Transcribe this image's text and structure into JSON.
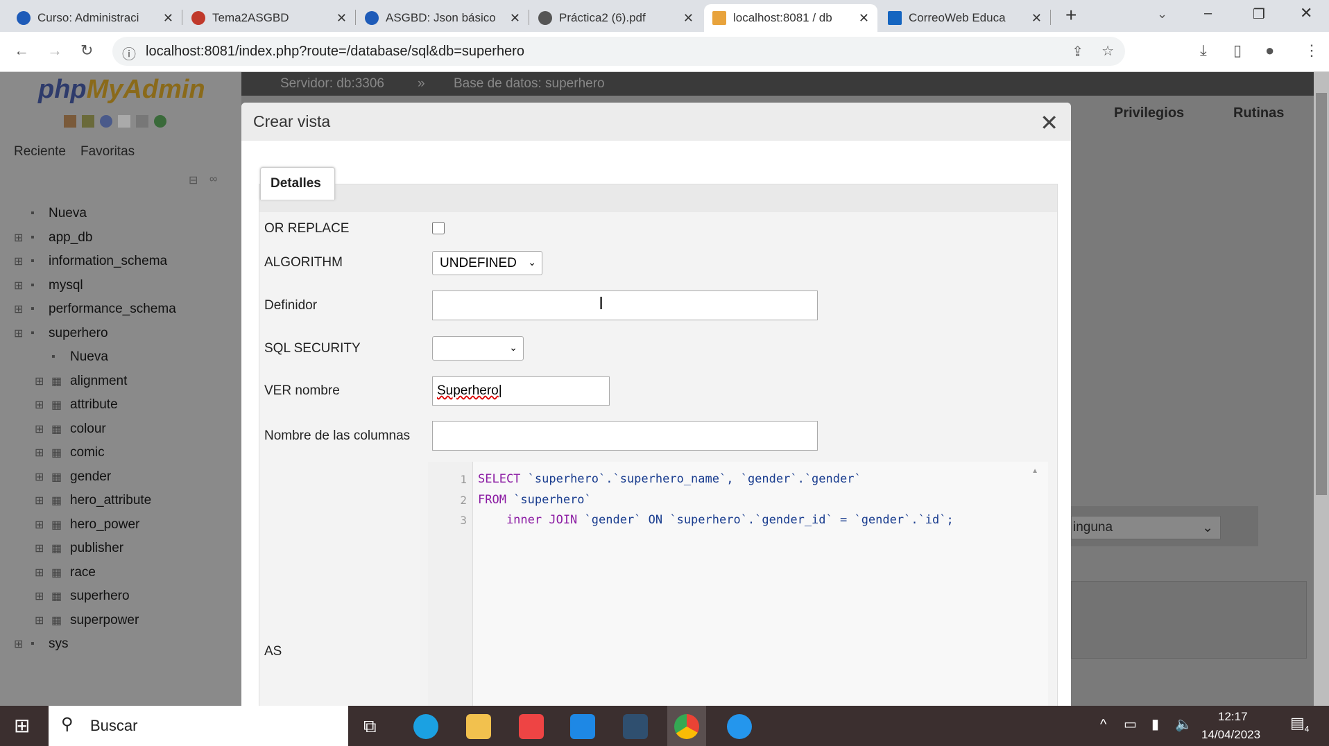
{
  "browser": {
    "tabs": [
      {
        "label": "Curso: Administraci",
        "color": "#1e5bb8"
      },
      {
        "label": "Tema2ASGBD",
        "color": "#c0392b"
      },
      {
        "label": "ASGBD: Json básico",
        "color": "#1e5bb8"
      },
      {
        "label": "Práctica2 (6).pdf",
        "color": "#555"
      },
      {
        "label": "localhost:8081 / db",
        "color": "#e8a33c"
      },
      {
        "label": "CorreoWeb Educa",
        "color": "#1565c0"
      }
    ],
    "url": "localhost:8081/index.php?route=/database/sql&db=superhero"
  },
  "pma": {
    "logo_php": "php",
    "logo_myadmin": "MyAdmin",
    "recent": "Reciente",
    "favorites": "Favoritas",
    "breadcrumb_server": "Servidor: db:3306",
    "breadcrumb_sep": "»",
    "breadcrumb_db": "Base de datos: superhero",
    "tab_privileges": "Privilegios",
    "tab_routines": "Rutinas",
    "behind_select": "inguna"
  },
  "tree": [
    {
      "label": "Nueva",
      "level": 0
    },
    {
      "label": "app_db",
      "level": 0
    },
    {
      "label": "information_schema",
      "level": 0
    },
    {
      "label": "mysql",
      "level": 0
    },
    {
      "label": "performance_schema",
      "level": 0
    },
    {
      "label": "superhero",
      "level": 0
    },
    {
      "label": "Nueva",
      "level": 1
    },
    {
      "label": "alignment",
      "level": 1
    },
    {
      "label": "attribute",
      "level": 1
    },
    {
      "label": "colour",
      "level": 1
    },
    {
      "label": "comic",
      "level": 1
    },
    {
      "label": "gender",
      "level": 1
    },
    {
      "label": "hero_attribute",
      "level": 1
    },
    {
      "label": "hero_power",
      "level": 1
    },
    {
      "label": "publisher",
      "level": 1
    },
    {
      "label": "race",
      "level": 1
    },
    {
      "label": "superhero",
      "level": 1
    },
    {
      "label": "superpower",
      "level": 1
    },
    {
      "label": "sys",
      "level": 0
    }
  ],
  "modal": {
    "title": "Crear vista",
    "tab": "Detalles",
    "or_replace": "OR REPLACE",
    "algorithm": "ALGORITHM",
    "algorithm_value": "UNDEFINED",
    "definer": "Definidor",
    "definer_value": "",
    "sql_security": "SQL SECURITY",
    "sql_security_value": "",
    "view_name": "VER nombre",
    "view_name_value": "Superhero",
    "column_names": "Nombre de las columnas",
    "column_names_value": "",
    "as": "AS",
    "code": [
      [
        "SELECT",
        " `superhero`.`superhero_name`, `gender`.`gender`"
      ],
      [
        "FROM",
        " `superhero`"
      ],
      [
        "    inner JOIN",
        " `gender` ON `superhero`.`gender_id` = `gender`.`id`;"
      ]
    ]
  },
  "taskbar": {
    "search": "Buscar",
    "time": "12:17",
    "date": "14/04/2023",
    "notifications": "4"
  }
}
